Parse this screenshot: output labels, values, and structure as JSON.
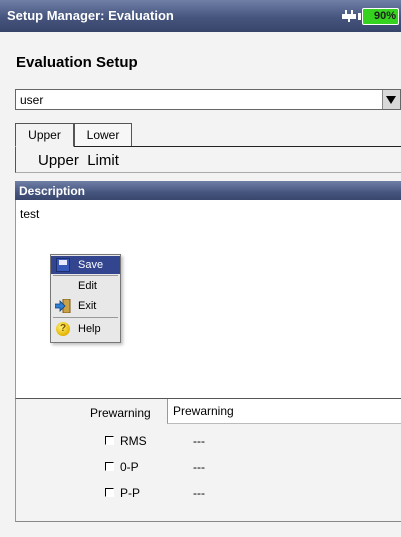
{
  "window": {
    "title": "Setup Manager: Evaluation",
    "battery": "90%"
  },
  "page": {
    "title": "Evaluation Setup"
  },
  "dropdown": {
    "value": "user"
  },
  "tabs": [
    {
      "label": "Upper"
    },
    {
      "label": "Lower"
    }
  ],
  "limit": {
    "label": "Upper  Limit"
  },
  "description": {
    "header": "Description",
    "text": "test"
  },
  "context_menu": {
    "items": [
      {
        "label": "Save",
        "icon": "save-icon",
        "selected": true
      },
      {
        "label": "Edit",
        "icon": ""
      },
      {
        "label": "Exit",
        "icon": "exit-arrow-icon"
      },
      {
        "label": "Help",
        "icon": "help-icon"
      }
    ]
  },
  "prewarning": {
    "label": "Prewarning",
    "value": "Prewarning",
    "checks": [
      {
        "label": "RMS",
        "value": "---"
      },
      {
        "label": "0-P",
        "value": "---"
      },
      {
        "label": "P-P",
        "value": "---"
      }
    ]
  },
  "colors": {
    "title_bar": "#46557e",
    "battery": "#35d21f",
    "menu_selection": "#34458f"
  }
}
